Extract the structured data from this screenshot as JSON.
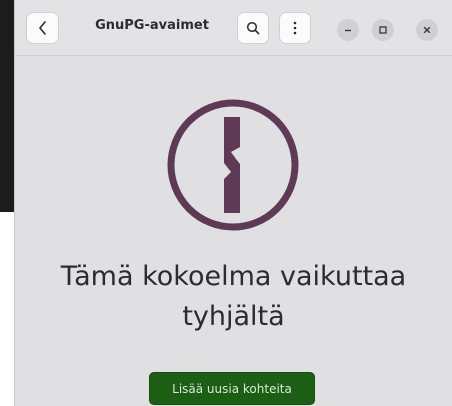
{
  "window": {
    "title": "GnuPG-avaimet"
  },
  "titlebar": {
    "back_icon": "chevron-left-icon",
    "search_icon": "search-icon",
    "menu_icon": "vertical-ellipsis-icon",
    "minimize_icon": "minimize-icon",
    "maximize_icon": "maximize-icon",
    "close_icon": "close-icon"
  },
  "empty_state": {
    "icon": "keyhole-icon",
    "line1": "Tämä kokoelma vaikuttaa",
    "line2": "tyhjältä",
    "button_label": "Lisää uusia kohteita"
  },
  "colors": {
    "accent_button": "#1b5e14",
    "icon_color": "#5e3a57",
    "background": "#e0e0e2"
  }
}
